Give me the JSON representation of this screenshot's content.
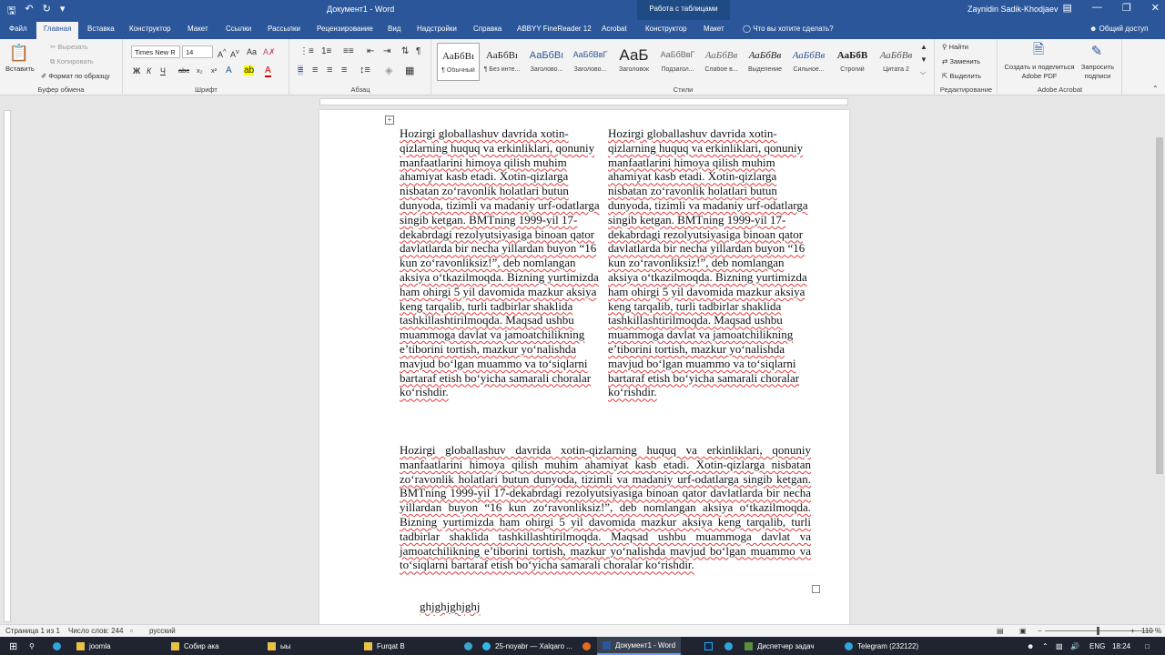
{
  "titlebar": {
    "document_title": "Документ1 - Word",
    "context_group": "Работа с таблицами",
    "user": "Zaynidin Sadik-Khodjaev"
  },
  "tabs": {
    "items": [
      "Файл",
      "Главная",
      "Вставка",
      "Конструктор",
      "Макет",
      "Ссылки",
      "Рассылки",
      "Рецензирование",
      "Вид",
      "Надстройки",
      "Справка",
      "ABBYY FineReader 12",
      "Acrobat",
      "Конструктор",
      "Макет"
    ],
    "tell_me": "Что вы хотите сделать?",
    "share": "Общий доступ"
  },
  "ribbon": {
    "clipboard": {
      "paste": "Вставить",
      "cut": "Вырезать",
      "copy": "Копировать",
      "format_painter": "Формат по образцу",
      "label": "Буфер обмена"
    },
    "font": {
      "font_name": "Times New R",
      "font_size": "14",
      "bold": "Ж",
      "italic": "К",
      "underline": "Ч",
      "strike": "abc",
      "subscript": "x₂",
      "superscript": "x²",
      "label": "Шрифт"
    },
    "paragraph": {
      "label": "Абзац"
    },
    "styles": {
      "items": [
        {
          "preview": "АаБбВı",
          "name": "¶ Обычный"
        },
        {
          "preview": "АаБбВı",
          "name": "¶ Без инте..."
        },
        {
          "preview": "АаБбВı",
          "name": "Заголово..."
        },
        {
          "preview": "АаБбВвГ",
          "name": "Заголово..."
        },
        {
          "preview": "АаБ",
          "name": "Заголовок"
        },
        {
          "preview": "АаБбВвГ",
          "name": "Подзагол..."
        },
        {
          "preview": "АаБбВв",
          "name": "Слабое в..."
        },
        {
          "preview": "АаБбВв",
          "name": "Выделение"
        },
        {
          "preview": "АаБбВв",
          "name": "Сильное..."
        },
        {
          "preview": "АаБбВ",
          "name": "Строгий"
        },
        {
          "preview": "АаБбВв",
          "name": "Цитата 2"
        }
      ],
      "label": "Стили"
    },
    "editing": {
      "find": "Найти",
      "replace": "Заменить",
      "select": "Выделить",
      "label": "Редактирование"
    },
    "acrobat": {
      "create_share": "Создать и поделиться Adobe PDF",
      "request_signatures": "Запросить подписи",
      "label": "Adobe Acrobat"
    }
  },
  "document": {
    "column_left": "Hozirgi globallashuv davrida xotin-qizlarning huquq va erkinliklari, qonuniy manfaatlarini himoya qilish muhim ahamiyat kasb etadi. Xotin-qizlarga nisbatan zo‘ravonlik holatlari butun dunyoda, tizimli va madaniy urf-odatlarga singib ketgan. BMTning 1999-yil 17-dekabrdagi rezolyutsiyasiga binoan qator davlatlarda bir necha yillardan buyon “16 kun zo‘ravonliksiz!”, deb nomlangan aksiya o‘tkazilmoqda. Bizning yurtimizda ham ohirgi 5 yil davomida mazkur aksiya keng tarqalib, turli tadbirlar shaklida tashkillashtirilmoqda. Maqsad ushbu muammoga davlat va jamoatchilikning e’tiborini tortish, mazkur yo‘nalishda mavjud bo‘lgan muammo va to‘siqlarni bartaraf etish bo‘yicha samarali choralar ko‘rishdir.",
    "column_right": "Hozirgi globallashuv davrida xotin-qizlarning huquq va erkinliklari, qonuniy manfaatlarini himoya qilish muhim ahamiyat kasb etadi. Xotin-qizlarga nisbatan zo‘ravonlik holatlari butun dunyoda, tizimli va madaniy urf-odatlarga singib ketgan. BMTning 1999-yil 17-dekabrdagi rezolyutsiyasiga binoan qator davlatlarda bir necha yillardan buyon “16 kun zo‘ravonliksiz!”, deb nomlangan aksiya o‘tkazilmoqda. Bizning yurtimizda ham ohirgi 5 yil davomida mazkur aksiya keng tarqalib, turli tadbirlar shaklida tashkillashtirilmoqda. Maqsad ushbu muammoga davlat va jamoatchilikning e’tiborini tortish, mazkur yo‘nalishda mavjud bo‘lgan muammo va to‘siqlarni bartaraf etish bo‘yicha samarali choralar ko‘rishdir.",
    "full_paragraph": "Hozirgi globallashuv davrida xotin-qizlarning huquq va erkinliklari, qonuniy manfaatlarini himoya qilish muhim ahamiyat kasb etadi. Xotin-qizlarga nisbatan zo‘ravonlik holatlari butun dunyoda, tizimli va madaniy urf-odatlarga singib ketgan. BMTning 1999-yil 17-dekabrdagi rezolyutsiyasiga binoan qator davlatlarda bir necha yillardan buyon “16 kun zo‘ravonliksiz!”, deb nomlangan aksiya o‘tkazilmoqda. Bizning yurtimizda ham ohirgi 5 yil davomida mazkur aksiya keng tarqalib, turli tadbirlar shaklida tashkillashtirilmoqda. Maqsad ushbu muammoga davlat va jamoatchilikning e’tiborini tortish, mazkur yo‘nalishda mavjud bo‘lgan muammo va to‘siqlarni bartaraf etish bo‘yicha samarali choralar ko‘rishdir.",
    "last_line": "ghjghjghjghj"
  },
  "status": {
    "page": "Страница 1 из 1",
    "words": "Число слов: 244",
    "language": "русский",
    "zoom": "110 %"
  },
  "taskbar": {
    "items": [
      "joomla",
      "Собир ака",
      "ыы",
      "Furqat B",
      "25-noyabr — Xalqaro ...",
      "Документ1 - Word",
      "Диспетчер задач",
      "Telegram (232122)"
    ],
    "lang": "ENG",
    "time": "18:24"
  },
  "colors": {
    "word_blue": "#2b579a",
    "taskbar": "#1f2430",
    "spell_underline": "#e23b3b"
  }
}
